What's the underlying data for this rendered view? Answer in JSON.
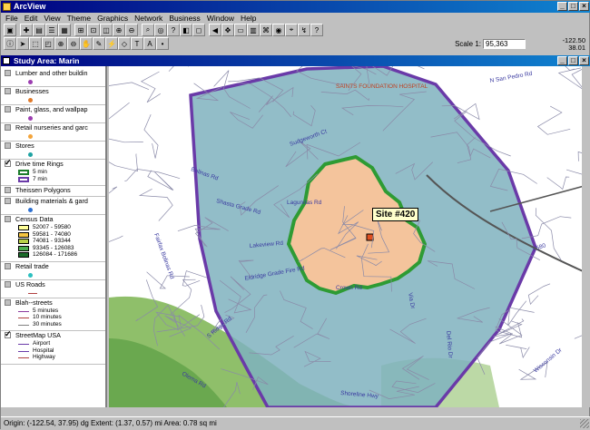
{
  "window": {
    "title": "ArcView",
    "doc_title": "Study Area: Marin"
  },
  "menu": [
    "File",
    "Edit",
    "View",
    "Theme",
    "Graphics",
    "Network",
    "Business",
    "Window",
    "Help"
  ],
  "scale": {
    "label": "Scale 1:",
    "value": "95,363"
  },
  "coords": {
    "x": "-122.50",
    "y": "38.01"
  },
  "status": "Origin: (-122.54, 37.95) dg  Extent: (1.37, 0.57) mi  Area: 0.78 sq mi",
  "layers": [
    {
      "name": "Lumber and other buildin",
      "checked": false,
      "symbol": "dot",
      "color": "#9b3db0"
    },
    {
      "name": "Businesses",
      "checked": false,
      "symbol": "dot",
      "color": "#e07a2a"
    },
    {
      "name": "Paint, glass, and wallpap",
      "checked": false,
      "symbol": "dot",
      "color": "#9b3db0"
    },
    {
      "name": "Retail nurseries and garc",
      "checked": false,
      "symbol": "dot",
      "color": "#f3a43b"
    },
    {
      "name": "Stores",
      "checked": false,
      "symbol": "dot",
      "color": "#1fa3a3"
    },
    {
      "name": "Drive time Rings",
      "checked": true,
      "symbol": "ring",
      "items": [
        {
          "label": "5 min",
          "color": "#1e7d2c"
        },
        {
          "label": "7 min",
          "color": "#6a3aa8"
        }
      ]
    },
    {
      "name": "Theissen Polygons",
      "checked": false,
      "symbol": "none"
    },
    {
      "name": "Building materials & gard",
      "checked": false,
      "symbol": "dot",
      "color": "#2c6fd0"
    },
    {
      "name": "Census Data",
      "checked": false,
      "symbol": "classes",
      "items": [
        {
          "label": "52007 - 59580",
          "color": "#ffff99"
        },
        {
          "label": "59581 - 74080",
          "color": "#f5c542"
        },
        {
          "label": "74081 - 93344",
          "color": "#b8d14a"
        },
        {
          "label": "93345 - 126083",
          "color": "#4caf50"
        },
        {
          "label": "126084 - 171686",
          "color": "#1b6b2a"
        }
      ]
    },
    {
      "name": "Retail trade",
      "checked": false,
      "symbol": "dot",
      "color": "#2cc0c0"
    },
    {
      "name": "US Roads",
      "checked": false,
      "symbol": "line",
      "color": "#b04040"
    },
    {
      "name": "Blah--streets",
      "checked": false,
      "symbol": "lines",
      "items": [
        {
          "label": "5 minutes",
          "color": "#8b3a9e"
        },
        {
          "label": "10 minutes",
          "color": "#b04040"
        },
        {
          "label": "30 minutes",
          "color": "#808080"
        }
      ]
    },
    {
      "name": "StreetMap USA",
      "checked": true,
      "symbol": "lines",
      "items": [
        {
          "label": "Airport",
          "color": "#6a3aa8"
        },
        {
          "label": "Hospital",
          "color": "#6a3aa8"
        },
        {
          "label": "Highway",
          "color": "#b04040"
        }
      ]
    }
  ],
  "map": {
    "site_label": "Site #420",
    "labels": [
      "SAINTS FOUNDATION HOSPITAL",
      "N San Pedro Rd",
      "Sudgeworth Ct",
      "Shasta Grade Rd",
      "Bolinas Rd",
      "Fairfax Bolinas Rd",
      "Lagunitas Rd",
      "Lakeview Rd",
      "Eldridge Grade Fire Rd",
      "Crown Rd",
      "S Ridge Rd",
      "Olema Rd",
      "Shoreline Hwy",
      "I 580",
      "Via Dr",
      "Del Rio Dr",
      "Wisconsin Dr"
    ]
  }
}
